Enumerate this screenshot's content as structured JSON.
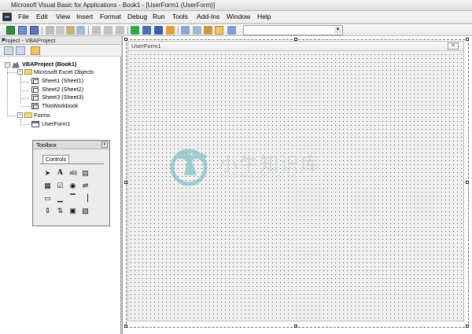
{
  "window": {
    "title": "Microsoft Visual Basic for Applications - Book1 - [UserForm1 (UserForm)]"
  },
  "menubar": {
    "app_icon": "vba-icon",
    "items": [
      "File",
      "Edit",
      "View",
      "Insert",
      "Format",
      "Debug",
      "Run",
      "Tools",
      "Add-Ins",
      "Window",
      "Help"
    ]
  },
  "toolbar": {
    "icons": [
      "excel-view-icon",
      "insert-userform-icon",
      "save-icon",
      "cut-icon",
      "copy-icon",
      "paste-icon",
      "find-icon",
      "undo-icon",
      "redo-icon",
      "run-icon",
      "break-icon",
      "reset-icon",
      "design-mode-icon",
      "project-explorer-icon",
      "properties-icon",
      "object-browser-icon",
      "toolbox-icon",
      "help-icon"
    ],
    "combo_value": ""
  },
  "project_panel": {
    "title": "Project - VBAProject",
    "close_label": "×",
    "tools": [
      "view-code-icon",
      "view-object-icon",
      "toggle-folders-icon"
    ]
  },
  "tree": {
    "root": "VBAProject (Book1)",
    "excel_folder": "Microsoft Excel Objects",
    "sheets": [
      "Sheet1 (Sheet1)",
      "Sheet2 (Sheet2)",
      "Sheet3 (Sheet3)",
      "ThisWorkbook"
    ],
    "forms_folder": "Forms",
    "forms": [
      "UserForm1"
    ]
  },
  "toolbox": {
    "title": "Toolbox",
    "close_label": "x",
    "tab": "Controls",
    "tools": [
      {
        "name": "select-objects-icon",
        "glyph": "➤"
      },
      {
        "name": "label-icon",
        "glyph": "A"
      },
      {
        "name": "textbox-icon",
        "glyph": "ab|"
      },
      {
        "name": "combobox-icon",
        "glyph": "▤"
      },
      {
        "name": "listbox-icon",
        "glyph": "▦"
      },
      {
        "name": "checkbox-icon",
        "glyph": "☑"
      },
      {
        "name": "optionbutton-icon",
        "glyph": "◉"
      },
      {
        "name": "togglebutton-icon",
        "glyph": "⇌"
      },
      {
        "name": "frame-icon",
        "glyph": "▭"
      },
      {
        "name": "commandbutton-icon",
        "glyph": "▁"
      },
      {
        "name": "tabstrip-icon",
        "glyph": "▔"
      },
      {
        "name": "multipage-icon",
        "glyph": "▕"
      },
      {
        "name": "scrollbar-icon",
        "glyph": "⇕"
      },
      {
        "name": "spinbutton-icon",
        "glyph": "⇅"
      },
      {
        "name": "image-icon",
        "glyph": "▣"
      },
      {
        "name": "refedit-icon",
        "glyph": "▧"
      }
    ]
  },
  "designer": {
    "form_caption": "UserForm1",
    "form_close_label": "✕"
  },
  "watermark": {
    "chinese": "小牛知识库",
    "pinyin": "XIAO NIU ZHI SHI KU",
    "logo": "bull-logo-icon"
  },
  "colors": {
    "selected_tool": "#f2c466",
    "watermark": "#5eb3bd"
  }
}
